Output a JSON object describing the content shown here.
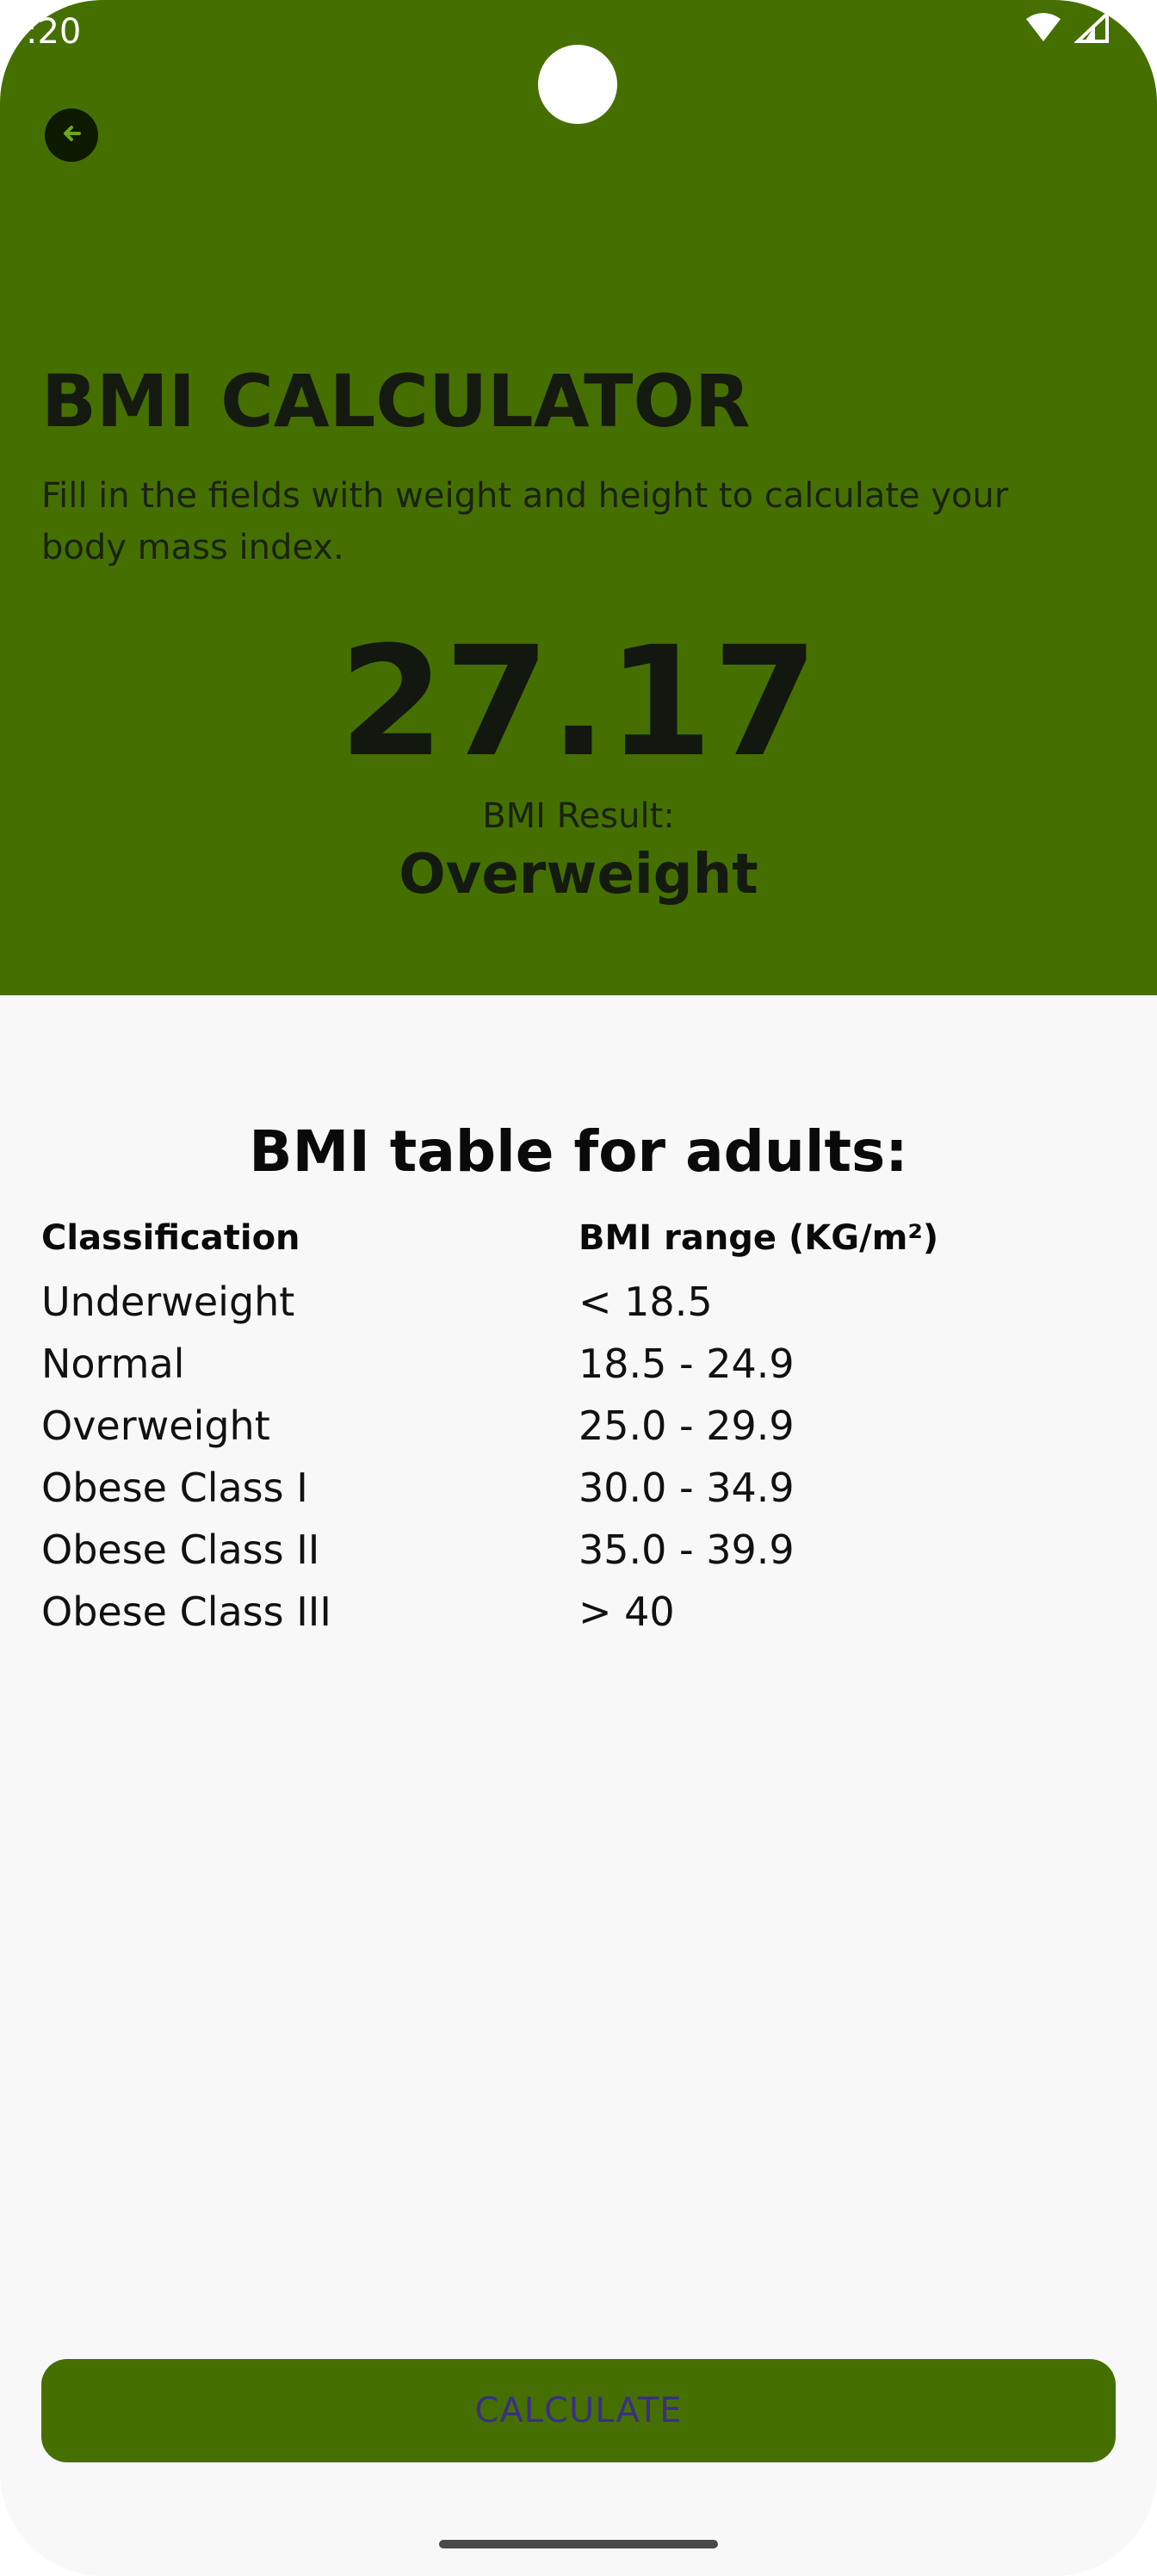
{
  "status_bar": {
    "time": ":20",
    "wifi_icon": "wifi-icon",
    "signal_icon": "cellular-signal-icon"
  },
  "header": {
    "back_icon": "arrow-left-icon",
    "title": "BMI CALCULATOR",
    "subtitle": "Fill in the fields with weight and height to calculate your body mass index.",
    "bmi_value": "27.17",
    "bmi_label": "BMI Result:",
    "bmi_classification": "Overweight"
  },
  "table": {
    "title": "BMI table for adults:",
    "headers": [
      "Classification",
      "BMI range (KG/m²)"
    ],
    "rows": [
      [
        "Underweight",
        "< 18.5"
      ],
      [
        "Normal",
        "18.5 - 24.9"
      ],
      [
        "Overweight",
        "25.0 - 29.9"
      ],
      [
        "Obese Class I",
        "30.0 - 34.9"
      ],
      [
        "Obese Class II",
        "35.0 - 39.9"
      ],
      [
        "Obese Class III",
        "> 40"
      ]
    ]
  },
  "actions": {
    "calculate_label": "CALCULATE"
  },
  "colors": {
    "header_bg": "#457000",
    "button_bg": "#457000",
    "button_text": "#3a2f86",
    "page_bg": "#f8f8f8"
  }
}
